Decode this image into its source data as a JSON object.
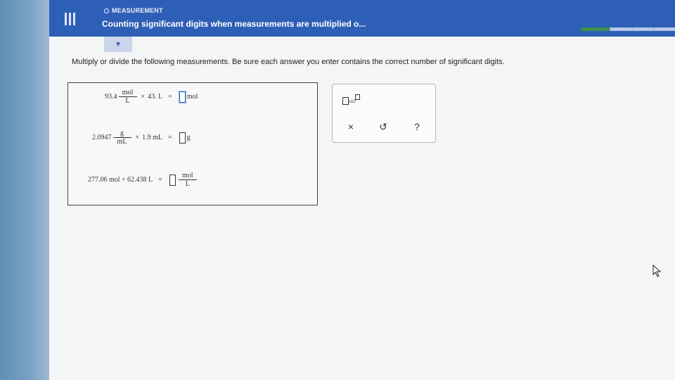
{
  "header": {
    "section_label": "MEASUREMENT",
    "title": "Counting significant digits when measurements are multiplied o..."
  },
  "instructions": "Multiply or divide the following measurements. Be sure each answer you enter contains the correct number of significant digits.",
  "equations": [
    {
      "coef": "93.4",
      "unit_num": "mol",
      "unit_den": "L",
      "operator": "×",
      "operand": "43. L",
      "equals": "=",
      "answer_unit": "mol"
    },
    {
      "coef": "2.0947",
      "unit_num": "g",
      "unit_den": "mL",
      "operator": "×",
      "operand": "1.9 mL",
      "equals": "=",
      "answer_unit": "g"
    },
    {
      "expression": "277.06 mol ÷ 62.438 L",
      "equals": "=",
      "answer_unit_num": "mol",
      "answer_unit_den": "L"
    }
  ],
  "tools": {
    "sci_notation_label": "x10",
    "clear": "×",
    "undo": "↺",
    "help": "?"
  },
  "colors": {
    "header_bg": "#2e5fb6",
    "progress_done": "#3f8f4f"
  }
}
